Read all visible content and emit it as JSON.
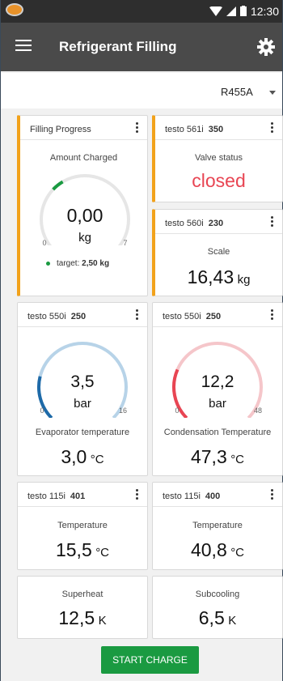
{
  "status_bar": {
    "time": "12:30"
  },
  "app_bar": {
    "title": "Refrigerant Filling"
  },
  "refrigerant": {
    "selected": "R455A"
  },
  "filling_card": {
    "title": "Filling Progress",
    "label": "Amount Charged",
    "value": "0,00",
    "unit": "kg",
    "gauge_min": "0",
    "gauge_max": "7",
    "target_prefix": "target:",
    "target_value": "2,50 kg",
    "target_fraction": 0.357
  },
  "valve_card": {
    "device": "testo 561i",
    "serial": "350",
    "label": "Valve status",
    "value": "closed"
  },
  "scale_card": {
    "device": "testo 560i",
    "serial": "230",
    "label": "Scale",
    "value": "16,43",
    "unit": "kg"
  },
  "evap_card": {
    "device": "testo 550i",
    "serial": "250",
    "gauge_value": "3,5",
    "gauge_unit": "bar",
    "gauge_min": "0",
    "gauge_max": "16",
    "gauge_fraction": 0.219,
    "label": "Evaporator temperature",
    "value": "3,0",
    "unit": "°C"
  },
  "cond_card": {
    "device": "testo 550i",
    "serial": "250",
    "gauge_value": "12,2",
    "gauge_unit": "bar",
    "gauge_min": "0",
    "gauge_max": "48",
    "gauge_fraction": 0.254,
    "label": "Condensation Temperature",
    "value": "47,3",
    "unit": "°C"
  },
  "temp1_card": {
    "device": "testo 115i",
    "serial": "401",
    "label": "Temperature",
    "value": "15,5",
    "unit": "°C"
  },
  "temp2_card": {
    "device": "testo 115i",
    "serial": "400",
    "label": "Temperature",
    "value": "40,8",
    "unit": "°C"
  },
  "superheat_card": {
    "label": "Superheat",
    "value": "12,5",
    "unit": "K"
  },
  "subcooling_card": {
    "label": "Subcooling",
    "value": "6,5",
    "unit": "K"
  },
  "action": {
    "start_label": "START CHARGE"
  },
  "colors": {
    "accent": "#f2a21b",
    "blue": "#1e6aa8",
    "light_blue": "#b7d3e8",
    "red": "#e84553",
    "light_red": "#f5c6ca",
    "green": "#1a9a41"
  }
}
